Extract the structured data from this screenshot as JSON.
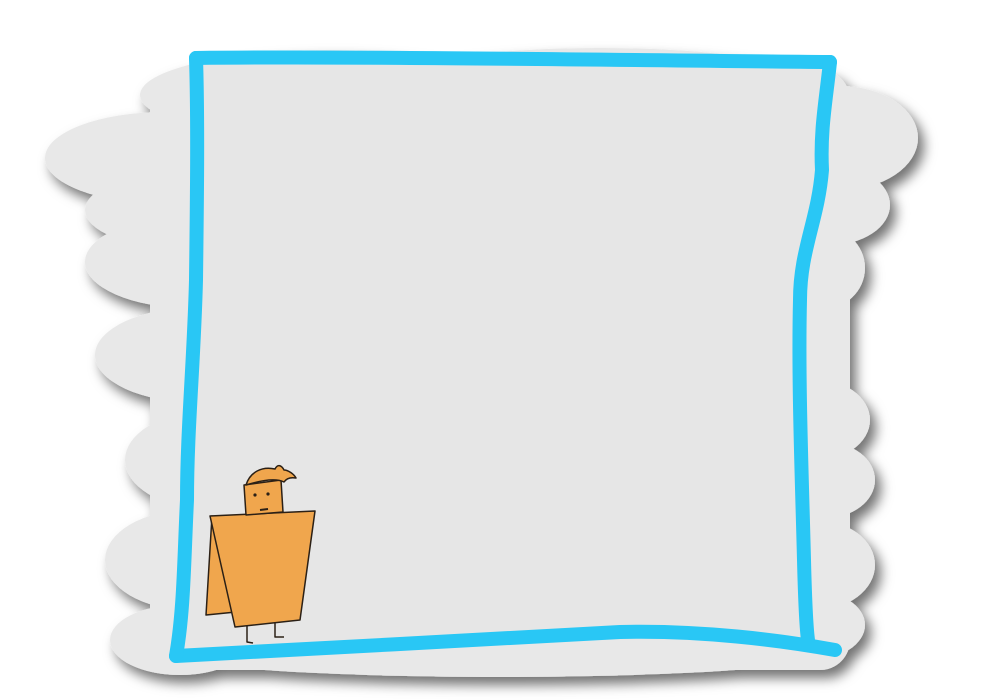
{
  "scene": {
    "description_visible_text": "",
    "colors": {
      "page_background": "#ffffff",
      "cloud_fill": "#e8e8e8",
      "cloud_shadow": "#000000",
      "panel_fill": "#e6e6e6",
      "border_stroke": "#29c7f5",
      "character_body": "#f0a64d",
      "character_outline": "#2b2016",
      "character_hair": "#f0a64d"
    },
    "elements": {
      "cloud_backdrop": "cloud-backdrop",
      "play_area": "hand-drawn-frame",
      "character": "orange-box-character"
    }
  }
}
